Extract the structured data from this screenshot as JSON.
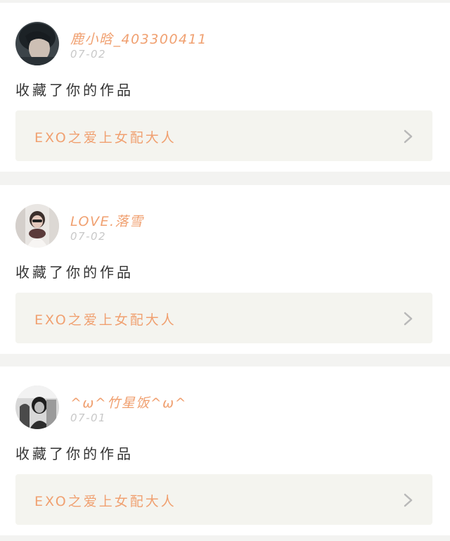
{
  "notifications": [
    {
      "username": "鹿小晗_403300411",
      "date": "07-02",
      "action": "收藏了你的作品",
      "work_title": "EXO之爱上女配大人",
      "avatar_icon": "user-avatar-icon",
      "chevron_icon": "chevron-right-icon"
    },
    {
      "username": "LOVE.落雪",
      "date": "07-02",
      "action": "收藏了你的作品",
      "work_title": "EXO之爱上女配大人",
      "avatar_icon": "user-avatar-icon",
      "chevron_icon": "chevron-right-icon"
    },
    {
      "username": "^ω^竹星饭^ω^",
      "date": "07-01",
      "action": "收藏了你的作品",
      "work_title": "EXO之爱上女配大人",
      "avatar_icon": "user-avatar-icon",
      "chevron_icon": "chevron-right-icon"
    }
  ],
  "colors": {
    "accent": "#f0a070",
    "date": "#c8c8c8",
    "text": "#333333",
    "card_bg": "#ffffff",
    "link_bg": "#f4f4ef",
    "page_bg": "#f3f3f1"
  }
}
